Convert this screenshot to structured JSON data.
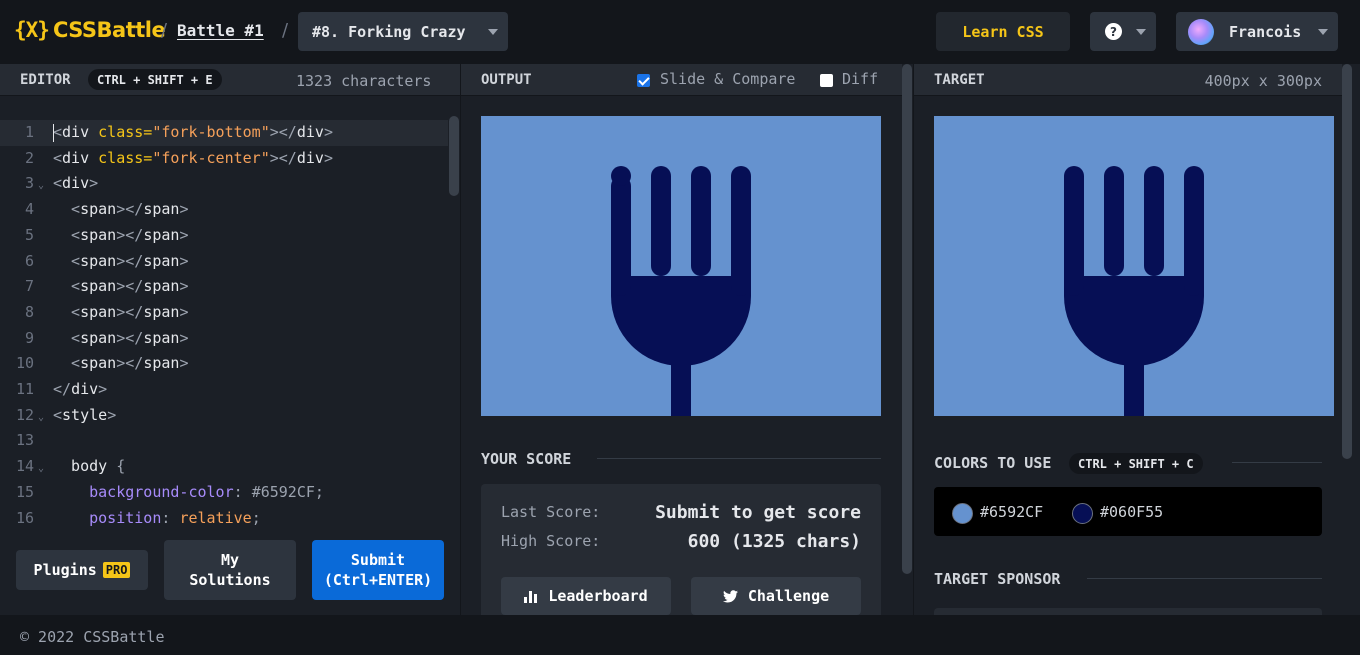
{
  "header": {
    "logo_mark": "{X}",
    "logo_text": "CSSBattle",
    "separator": "/",
    "battle_link": "Battle #1",
    "challenge_select": "#8. Forking Crazy",
    "learn_button": "Learn CSS",
    "help_icon_text": "?",
    "user_name": "Francois"
  },
  "editor": {
    "title": "EDITOR",
    "shortcut": "CTRL + SHIFT + E",
    "char_count": "1323 characters",
    "lines": [
      {
        "n": "1",
        "tokens": [
          [
            "t-punct",
            "<"
          ],
          [
            "t-tag",
            "div "
          ],
          [
            "t-attr",
            "class="
          ],
          [
            "t-str",
            "\"fork-bottom\""
          ],
          [
            "t-punct",
            "></"
          ],
          [
            "t-tag",
            "div"
          ],
          [
            "t-punct",
            ">"
          ]
        ]
      },
      {
        "n": "2",
        "tokens": [
          [
            "t-punct",
            "<"
          ],
          [
            "t-tag",
            "div "
          ],
          [
            "t-attr",
            "class="
          ],
          [
            "t-str",
            "\"fork-center\""
          ],
          [
            "t-punct",
            "></"
          ],
          [
            "t-tag",
            "div"
          ],
          [
            "t-punct",
            ">"
          ]
        ]
      },
      {
        "n": "3",
        "fold": true,
        "tokens": [
          [
            "t-punct",
            "<"
          ],
          [
            "t-tag",
            "div"
          ],
          [
            "t-punct",
            ">"
          ]
        ]
      },
      {
        "n": "4",
        "tokens": [
          [
            "t-punct",
            "  <"
          ],
          [
            "t-tag",
            "span"
          ],
          [
            "t-punct",
            "></"
          ],
          [
            "t-tag",
            "span"
          ],
          [
            "t-punct",
            ">"
          ]
        ]
      },
      {
        "n": "5",
        "tokens": [
          [
            "t-punct",
            "  <"
          ],
          [
            "t-tag",
            "span"
          ],
          [
            "t-punct",
            "></"
          ],
          [
            "t-tag",
            "span"
          ],
          [
            "t-punct",
            ">"
          ]
        ]
      },
      {
        "n": "6",
        "tokens": [
          [
            "t-punct",
            "  <"
          ],
          [
            "t-tag",
            "span"
          ],
          [
            "t-punct",
            "></"
          ],
          [
            "t-tag",
            "span"
          ],
          [
            "t-punct",
            ">"
          ]
        ]
      },
      {
        "n": "7",
        "tokens": [
          [
            "t-punct",
            "  <"
          ],
          [
            "t-tag",
            "span"
          ],
          [
            "t-punct",
            "></"
          ],
          [
            "t-tag",
            "span"
          ],
          [
            "t-punct",
            ">"
          ]
        ]
      },
      {
        "n": "8",
        "tokens": [
          [
            "t-punct",
            "  <"
          ],
          [
            "t-tag",
            "span"
          ],
          [
            "t-punct",
            "></"
          ],
          [
            "t-tag",
            "span"
          ],
          [
            "t-punct",
            ">"
          ]
        ]
      },
      {
        "n": "9",
        "tokens": [
          [
            "t-punct",
            "  <"
          ],
          [
            "t-tag",
            "span"
          ],
          [
            "t-punct",
            "></"
          ],
          [
            "t-tag",
            "span"
          ],
          [
            "t-punct",
            ">"
          ]
        ]
      },
      {
        "n": "10",
        "tokens": [
          [
            "t-punct",
            "  <"
          ],
          [
            "t-tag",
            "span"
          ],
          [
            "t-punct",
            "></"
          ],
          [
            "t-tag",
            "span"
          ],
          [
            "t-punct",
            ">"
          ]
        ]
      },
      {
        "n": "11",
        "tokens": [
          [
            "t-punct",
            "</"
          ],
          [
            "t-tag",
            "div"
          ],
          [
            "t-punct",
            ">"
          ]
        ]
      },
      {
        "n": "12",
        "fold": true,
        "tokens": [
          [
            "t-punct",
            "<"
          ],
          [
            "t-tag",
            "style"
          ],
          [
            "t-punct",
            ">"
          ]
        ]
      },
      {
        "n": "13",
        "tokens": []
      },
      {
        "n": "14",
        "fold": true,
        "tokens": [
          [
            "t-tag",
            "  body "
          ],
          [
            "t-punct",
            "{"
          ]
        ]
      },
      {
        "n": "15",
        "tokens": [
          [
            "t-prop",
            "    background-color"
          ],
          [
            "t-punct",
            ": "
          ],
          [
            "t-hex",
            "#6592CF"
          ],
          [
            "t-punct",
            ";"
          ]
        ]
      },
      {
        "n": "16",
        "tokens": [
          [
            "t-prop",
            "    position"
          ],
          [
            "t-punct",
            ": "
          ],
          [
            "t-val",
            "relative"
          ],
          [
            "t-punct",
            ";"
          ]
        ]
      }
    ],
    "plugins_label": "Plugins",
    "pro_badge": "PRO",
    "my_solutions_line1": "My",
    "my_solutions_line2": "Solutions",
    "submit_line1": "Submit",
    "submit_line2": "(Ctrl+ENTER)"
  },
  "output": {
    "title": "OUTPUT",
    "slide_compare_label": "Slide & Compare",
    "slide_compare_checked": true,
    "diff_label": "Diff",
    "diff_checked": false
  },
  "score": {
    "title": "YOUR SCORE",
    "last_label": "Last Score:",
    "last_value": "Submit to get score",
    "high_label": "High Score:",
    "high_value": "600 (1325 chars)",
    "leaderboard_label": "Leaderboard",
    "challenge_label": "Challenge"
  },
  "target": {
    "title": "TARGET",
    "dimensions": "400px x 300px",
    "colors_title": "COLORS TO USE",
    "colors_shortcut": "CTRL + SHIFT + C",
    "colors": [
      "#6592CF",
      "#060F55"
    ],
    "sponsor_title": "TARGET SPONSOR"
  },
  "footer": {
    "copyright": "© 2022 CSSBattle"
  },
  "theme": {
    "accent_yellow": "#f5c518",
    "submit_blue": "#0a6ad8",
    "background_blue": "#6592CF",
    "fork_navy": "#060F55"
  }
}
